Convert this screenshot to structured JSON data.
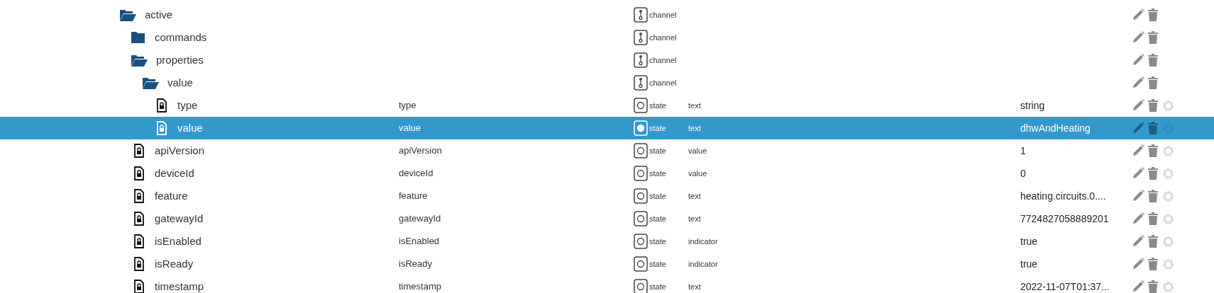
{
  "tree": [
    {
      "kind": "folder",
      "name": "active",
      "expanded": true,
      "selected": false,
      "object_type": "channel",
      "children": [
        {
          "kind": "folder",
          "name": "commands",
          "expanded": false,
          "selected": false,
          "object_type": "channel"
        },
        {
          "kind": "folder",
          "name": "properties",
          "expanded": true,
          "selected": false,
          "object_type": "channel",
          "children": [
            {
              "kind": "folder",
              "name": "value",
              "expanded": true,
              "selected": false,
              "object_type": "channel",
              "children": [
                {
                  "kind": "file",
                  "name": "type",
                  "selected": false,
                  "label": "type",
                  "object_type": "state",
                  "role": "text",
                  "value": "string"
                },
                {
                  "kind": "file",
                  "name": "value",
                  "selected": true,
                  "label": "value",
                  "object_type": "state",
                  "role": "text",
                  "value": "dhwAndHeating"
                }
              ]
            }
          ]
        },
        {
          "kind": "file",
          "name": "apiVersion",
          "selected": false,
          "label": "apiVersion",
          "object_type": "state",
          "role": "value",
          "value": "1"
        },
        {
          "kind": "file",
          "name": "deviceId",
          "selected": false,
          "label": "deviceId",
          "object_type": "state",
          "role": "value",
          "value": "0"
        },
        {
          "kind": "file",
          "name": "feature",
          "selected": false,
          "label": "feature",
          "object_type": "state",
          "role": "text",
          "value": "heating.circuits.0...."
        },
        {
          "kind": "file",
          "name": "gatewayId",
          "selected": false,
          "label": "gatewayId",
          "object_type": "state",
          "role": "text",
          "value": "7724827058889201"
        },
        {
          "kind": "file",
          "name": "isEnabled",
          "selected": false,
          "label": "isEnabled",
          "object_type": "state",
          "role": "indicator",
          "value": "true"
        },
        {
          "kind": "file",
          "name": "isReady",
          "selected": false,
          "label": "isReady",
          "object_type": "state",
          "role": "indicator",
          "value": "true"
        },
        {
          "kind": "file",
          "name": "timestamp",
          "selected": false,
          "label": "timestamp",
          "object_type": "state",
          "role": "text",
          "value": "2022-11-07T01:37..."
        }
      ]
    }
  ]
}
